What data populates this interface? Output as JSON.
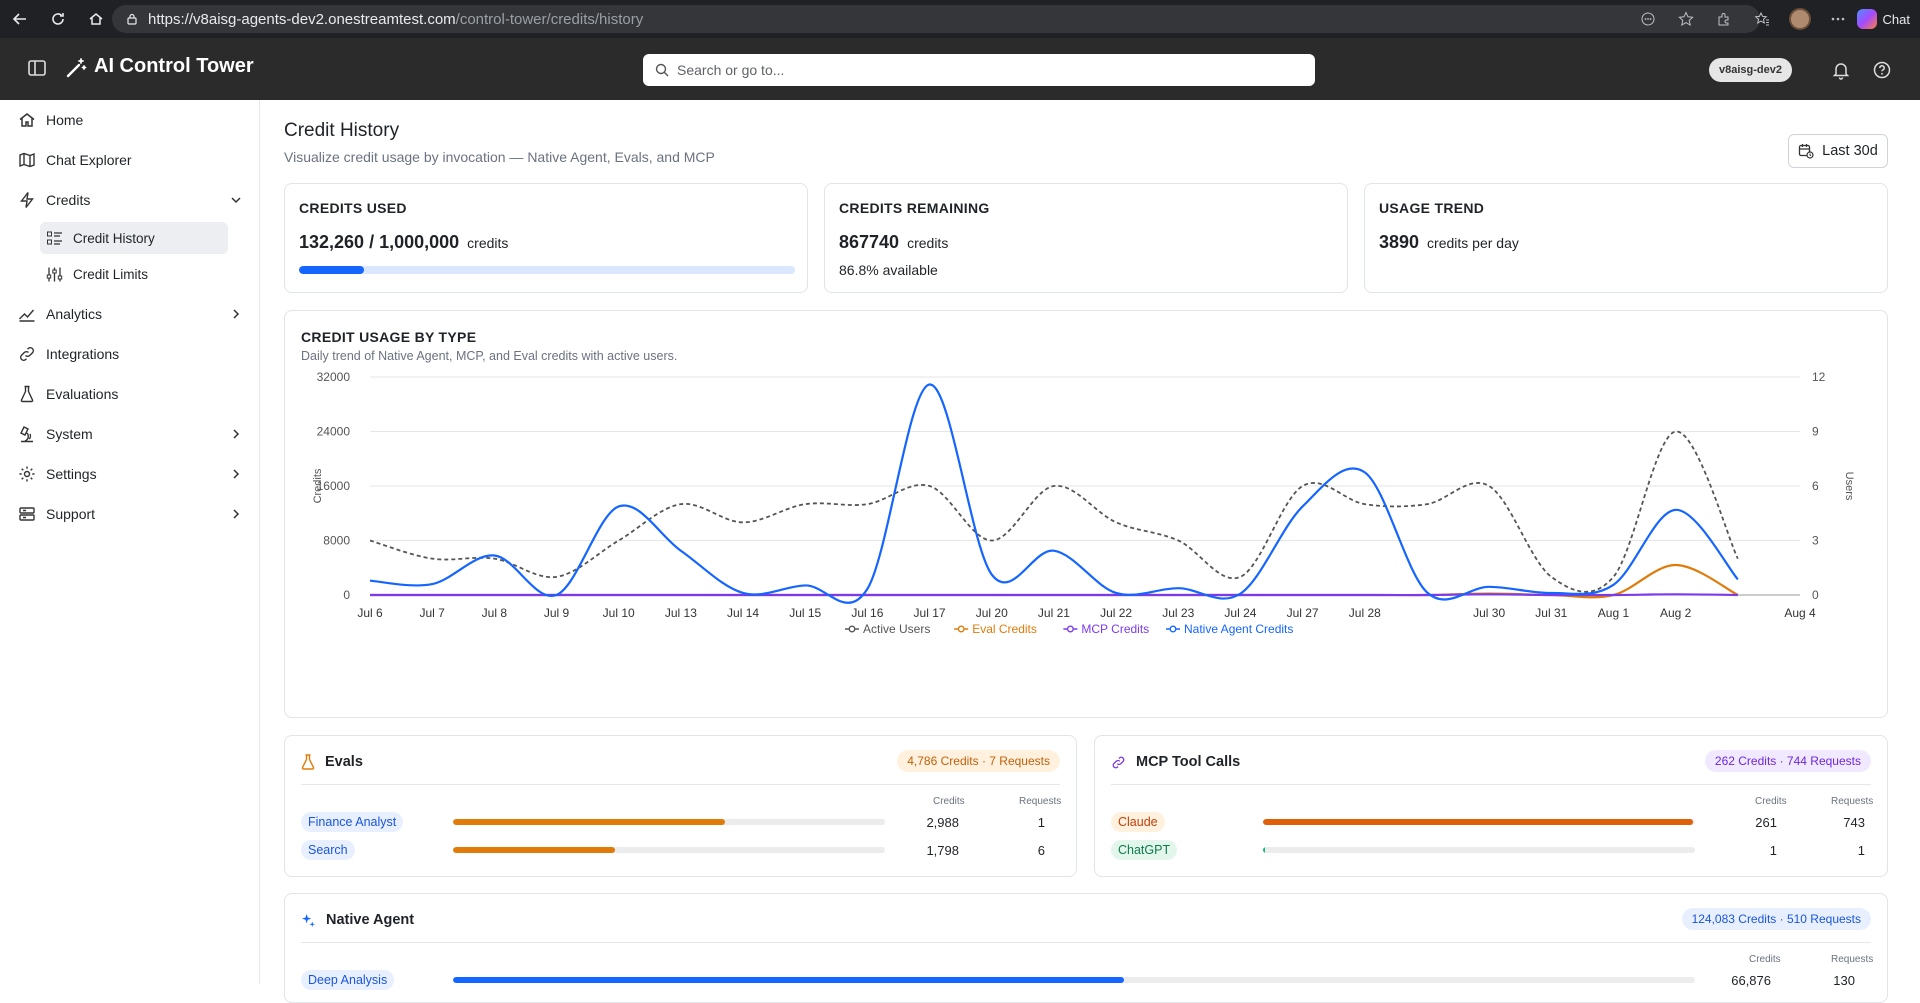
{
  "browser": {
    "url_domain": "https://v8aisg-agents-dev2.onestreamtest.com",
    "url_path": "/control-tower/credits/history",
    "chat_label": "Chat"
  },
  "header": {
    "brand": "AI Control Tower",
    "search_placeholder": "Search or go to...",
    "tenant": "v8aisg-dev2"
  },
  "sidebar": {
    "items": [
      {
        "label": "Home"
      },
      {
        "label": "Chat Explorer"
      },
      {
        "label": "Credits"
      },
      {
        "label": "Analytics"
      },
      {
        "label": "Integrations"
      },
      {
        "label": "Evaluations"
      },
      {
        "label": "System"
      },
      {
        "label": "Settings"
      },
      {
        "label": "Support"
      }
    ],
    "credits_sub": [
      {
        "label": "Credit History"
      },
      {
        "label": "Credit Limits"
      }
    ]
  },
  "page": {
    "title": "Credit History",
    "subtitle": "Visualize credit usage by invocation — Native Agent, Evals, and MCP",
    "range_label": "Last 30d"
  },
  "kpis": {
    "used": {
      "label": "CREDITS USED",
      "value": "132,260 / 1,000,000",
      "unit": "credits",
      "fraction": 0.13226
    },
    "remaining": {
      "label": "CREDITS REMAINING",
      "value": "867740",
      "unit": "credits",
      "sub": "86.8% available"
    },
    "trend": {
      "label": "USAGE TREND",
      "value": "3890",
      "unit": "credits per day"
    }
  },
  "chart_section": {
    "title": "CREDIT USAGE BY TYPE",
    "subtitle": "Daily trend of Native Agent, MCP, and Eval credits with active users."
  },
  "chart_data": {
    "type": "line",
    "x": [
      "Jul 6",
      "Jul 7",
      "Jul 8",
      "Jul 9",
      "Jul 10",
      "Jul 13",
      "Jul 14",
      "Jul 15",
      "Jul 16",
      "Jul 17",
      "Jul 20",
      "Jul 21",
      "Jul 22",
      "Jul 23",
      "Jul 24",
      "Jul 27",
      "Jul 28",
      "Jul 30",
      "Jul 31",
      "Aug 1",
      "Aug 2",
      "Aug 4"
    ],
    "ylabel": "Credits",
    "y2label": "Users",
    "ylim": [
      0,
      32000
    ],
    "y2lim": [
      0,
      12
    ],
    "yticks": [
      0,
      8000,
      16000,
      24000,
      32000
    ],
    "y2ticks": [
      0,
      3,
      6,
      9,
      12
    ],
    "grid": "horizontal",
    "legend_position": "bottom",
    "series": [
      {
        "name": "Active Users",
        "axis": "right",
        "color": "#555555",
        "dashed": true,
        "values": [
          3,
          2,
          2,
          1,
          3,
          5,
          4,
          5,
          5,
          6,
          3,
          6,
          4,
          3,
          1,
          6,
          5,
          5,
          6,
          1,
          1,
          9,
          2
        ]
      },
      {
        "name": "Eval Credits",
        "axis": "left",
        "color": "#e07b0a",
        "values": [
          0,
          0,
          0,
          0,
          0,
          0,
          0,
          0,
          0,
          0,
          0,
          0,
          0,
          0,
          0,
          0,
          0,
          0,
          200,
          0,
          0,
          4400,
          0
        ]
      },
      {
        "name": "MCP Credits",
        "axis": "left",
        "color": "#7c3aed",
        "values": [
          0,
          0,
          0,
          0,
          0,
          0,
          0,
          0,
          0,
          0,
          0,
          0,
          0,
          0,
          0,
          0,
          0,
          0,
          100,
          0,
          0,
          100,
          0
        ]
      },
      {
        "name": "Native Agent Credits",
        "axis": "left",
        "color": "#1565ff",
        "values": [
          2100,
          1600,
          5800,
          0,
          13000,
          6500,
          300,
          1400,
          900,
          30900,
          3000,
          6500,
          300,
          1000,
          200,
          13000,
          18000,
          400,
          1200,
          300,
          1500,
          12500,
          2300
        ]
      }
    ],
    "x_positions_index": [
      0,
      1,
      2,
      3,
      4,
      5,
      6,
      7,
      8,
      9,
      10,
      11,
      12,
      13,
      14,
      15,
      16,
      18,
      19,
      20,
      21,
      23
    ]
  },
  "evals": {
    "title": "Evals",
    "summary": "4,786 Credits · 7 Requests",
    "col_credits": "Credits",
    "col_requests": "Requests",
    "rows": [
      {
        "name": "Finance Analyst",
        "credits": "2,988",
        "requests": "1",
        "fraction": 0.63
      },
      {
        "name": "Search",
        "credits": "1,798",
        "requests": "6",
        "fraction": 0.375
      }
    ]
  },
  "mcp": {
    "title": "MCP Tool Calls",
    "summary": "262 Credits · 744 Requests",
    "col_credits": "Credits",
    "col_requests": "Requests",
    "rows": [
      {
        "name": "Claude",
        "credits": "261",
        "requests": "743",
        "fraction": 0.996
      },
      {
        "name": "ChatGPT",
        "credits": "1",
        "requests": "1",
        "fraction": 0.004
      }
    ]
  },
  "native": {
    "title": "Native Agent",
    "summary": "124,083 Credits · 510 Requests",
    "col_credits": "Credits",
    "col_requests": "Requests",
    "rows": [
      {
        "name": "Deep Analysis",
        "credits": "66,876",
        "requests": "130",
        "fraction": 0.54
      }
    ]
  }
}
